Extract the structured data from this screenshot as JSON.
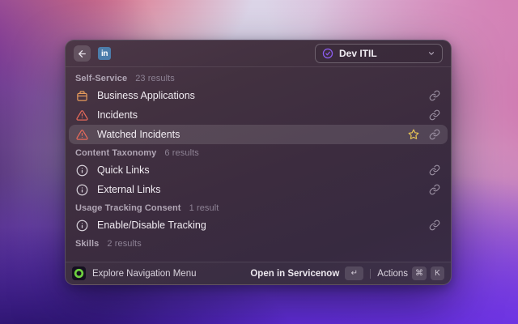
{
  "header": {
    "app_badge": "in",
    "workspace_dropdown": {
      "label": "Dev ITIL",
      "icon": "check-circle-icon"
    }
  },
  "sections": [
    {
      "title": "Self-Service",
      "count": "23 results",
      "items": [
        {
          "label": "Business Applications",
          "icon": "briefcase-icon",
          "has_link": true
        },
        {
          "label": "Incidents",
          "icon": "warning-triangle-icon",
          "has_link": true
        },
        {
          "label": "Watched Incidents",
          "icon": "warning-triangle-icon",
          "has_link": true,
          "selected": true,
          "starred": true
        }
      ]
    },
    {
      "title": "Content Taxonomy",
      "count": "6 results",
      "items": [
        {
          "label": "Quick Links",
          "icon": "info-icon",
          "has_link": true
        },
        {
          "label": "External Links",
          "icon": "info-icon",
          "has_link": true
        }
      ]
    },
    {
      "title": "Usage Tracking Consent",
      "count": "1 result",
      "items": [
        {
          "label": "Enable/Disable Tracking",
          "icon": "info-icon",
          "has_link": true
        }
      ]
    },
    {
      "title": "Skills",
      "count": "2 results",
      "items": []
    }
  ],
  "footer": {
    "left_label": "Explore Navigation Menu",
    "open_label": "Open in Servicenow",
    "return_key": "↵",
    "actions_label": "Actions",
    "cmd_key": "⌘",
    "k_key": "K"
  },
  "colors": {
    "warning_red": "#e4695a",
    "briefcase_orange": "#e59a5b",
    "star_yellow": "#e8c554",
    "accent_purple": "#8d5df2",
    "linkedin_blue": "#4c7dab",
    "servicenow_green": "#6ecf3f",
    "selection_bg": "rgba(255,255,255,0.12)"
  }
}
